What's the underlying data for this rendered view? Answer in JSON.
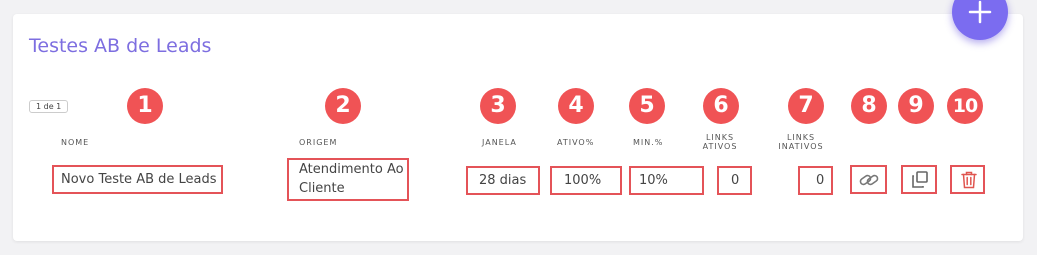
{
  "card": {
    "title": "Testes AB de Leads"
  },
  "fab": {
    "icon": "plus-icon",
    "color": "#7b6cf0"
  },
  "pager": {
    "text": "1 de 1"
  },
  "headers": {
    "nome": "NOME",
    "origem": "ORIGEM",
    "janela": "JANELA",
    "ativo": "ATIVO%",
    "min": "MIN.%",
    "links_ativos_1": "LINKS",
    "links_ativos_2": "ATIVOS",
    "links_inativos_1": "LINKS",
    "links_inativos_2": "INATIVOS"
  },
  "markers": [
    "1",
    "2",
    "3",
    "4",
    "5",
    "6",
    "7",
    "8",
    "9",
    "10"
  ],
  "row": {
    "nome": "Novo Teste AB de Leads",
    "origem_line1": "Atendimento Ao",
    "origem_line2": "Cliente",
    "janela": "28 dias",
    "ativo": "100%",
    "min": "10%",
    "links_ativos": "0",
    "links_inativos": "0",
    "actions": [
      "link-icon",
      "copy-icon",
      "trash-icon"
    ]
  },
  "colors": {
    "accent": "#7d6ee0",
    "highlight": "#e45358",
    "marker": "#f05355",
    "trash": "#e0554f"
  }
}
